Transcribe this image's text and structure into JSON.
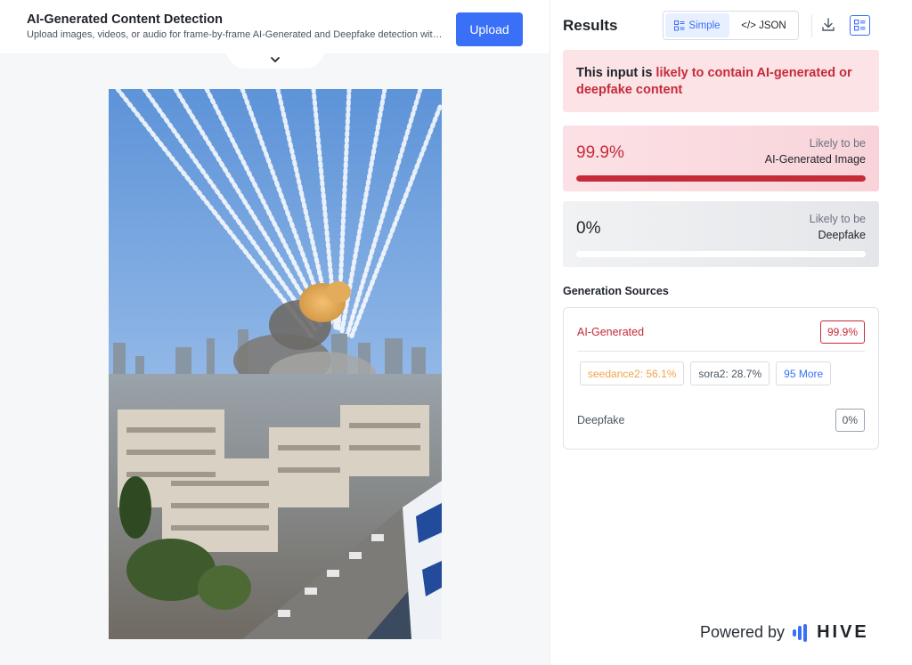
{
  "header": {
    "title": "AI-Generated Content Detection",
    "subtitle": "Upload images, videos, or audio for frame-by-frame AI-Generated and Deepfake detection with...",
    "upload_label": "Upload"
  },
  "results": {
    "title": "Results",
    "toggle": {
      "simple_label": "Simple",
      "json_label": "</> JSON"
    },
    "verdict": {
      "prefix": "This input is ",
      "highlight": "likely to contain AI-generated or deepfake content"
    },
    "ai_card": {
      "value": "99.9%",
      "fill": 0.999,
      "caption_top": "Likely to be",
      "caption_bottom": "AI-Generated Image"
    },
    "deepfake_card": {
      "value": "0%",
      "fill": 0.0,
      "caption_top": "Likely to be",
      "caption_bottom": "Deepfake"
    }
  },
  "generation_sources": {
    "title": "Generation Sources",
    "ai_label": "AI-Generated",
    "ai_value": "99.9%",
    "chips": [
      "seedance2: 56.1%",
      "sora2: 28.7%",
      "95 More"
    ],
    "deepfake_label": "Deepfake",
    "deepfake_value": "0%"
  },
  "footer": {
    "powered_by": "Powered by",
    "brand": "HIVE"
  },
  "colors": {
    "accent_blue": "#3a6ff7",
    "alert_red": "#c62b3a",
    "chip_orange": "#f0a44b"
  },
  "icons": [
    "chevron-down-icon",
    "simple-view-icon",
    "download-icon",
    "list-view-icon",
    "hive-logo-icon"
  ]
}
